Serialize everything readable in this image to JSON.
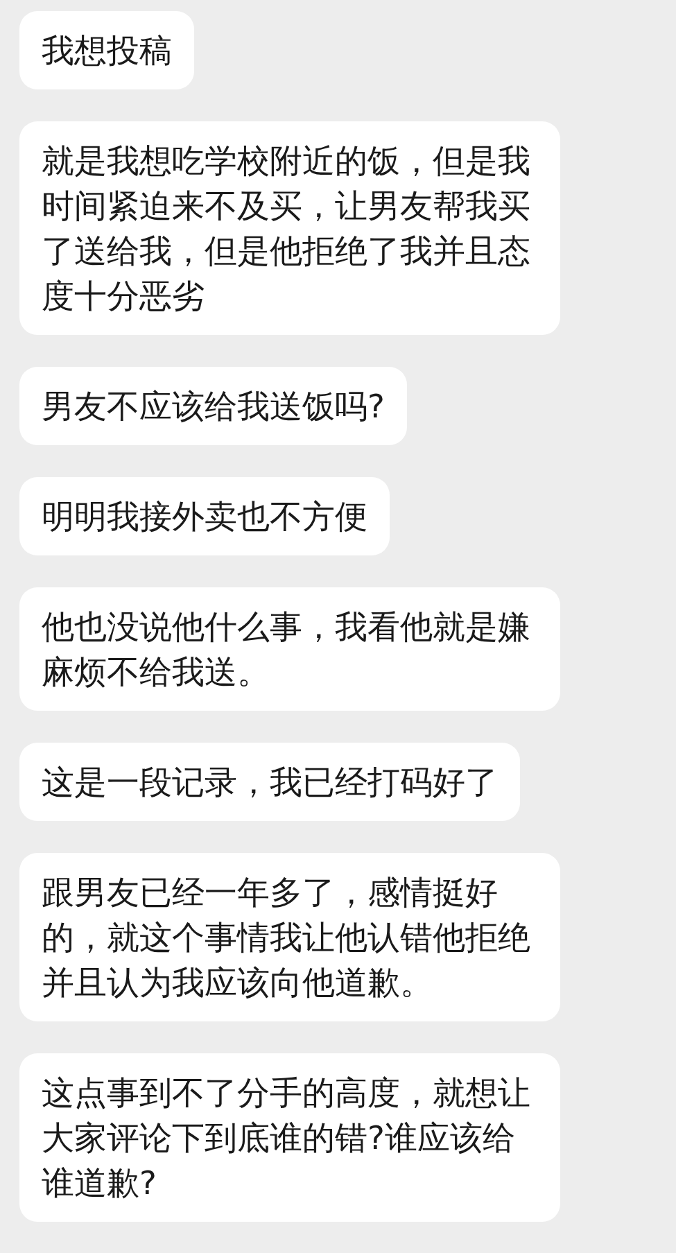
{
  "messages": [
    {
      "text": "我想投稿"
    },
    {
      "text": "就是我想吃学校附近的饭，但是我时间紧迫来不及买，让男友帮我买了送给我，但是他拒绝了我并且态度十分恶劣"
    },
    {
      "text": "男友不应该给我送饭吗?"
    },
    {
      "text": "明明我接外卖也不方便"
    },
    {
      "text": "他也没说他什么事，我看他就是嫌麻烦不给我送。"
    },
    {
      "text": "这是一段记录，我已经打码好了"
    },
    {
      "text": "跟男友已经一年多了，感情挺好的，就这个事情我让他认错他拒绝并且认为我应该向他道歉。"
    },
    {
      "text": "这点事到不了分手的高度，就想让大家评论下到底谁的错?谁应该给谁道歉?"
    }
  ]
}
